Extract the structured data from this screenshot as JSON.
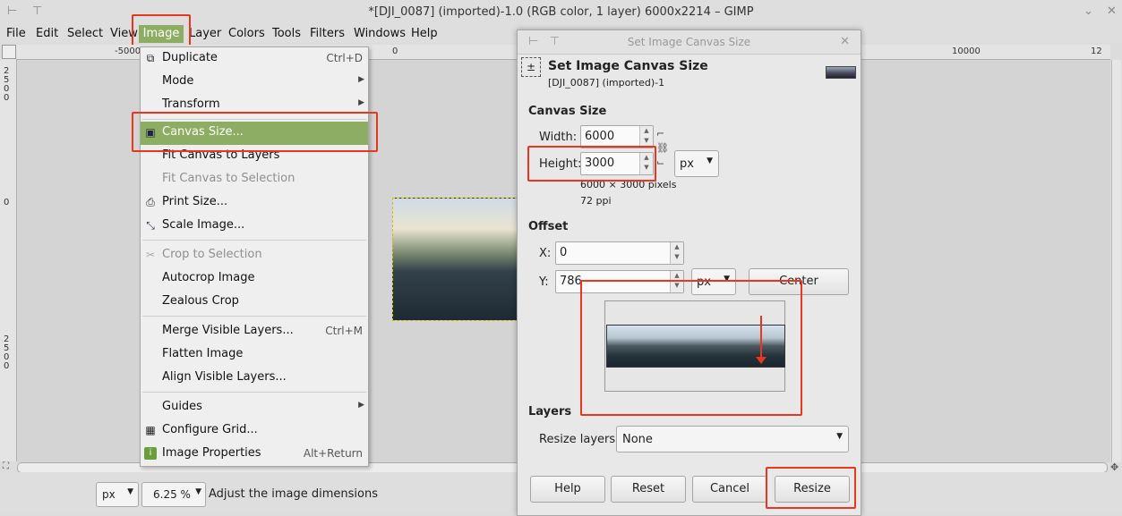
{
  "window": {
    "title": "*[DJI_0087] (imported)-1.0 (RGB color, 1 layer) 6000x2214 – GIMP",
    "pin_icon": "pin-icon",
    "up_icon": "up-arrow-icon"
  },
  "menubar": [
    "File",
    "Edit",
    "Select",
    "View",
    "Image",
    "Layer",
    "Colors",
    "Tools",
    "Filters",
    "Windows",
    "Help"
  ],
  "ruler": {
    "h_ticks": [
      "-5000",
      "0",
      "10000",
      "12"
    ],
    "v_ticks_top": [
      "2",
      "5",
      "0",
      "0"
    ],
    "v_tick_mid": "0",
    "v_ticks_bottom": [
      "2",
      "5",
      "0",
      "0"
    ]
  },
  "image_menu": {
    "items": [
      {
        "label": "Duplicate",
        "accel": "Ctrl+D",
        "icon": "duplicate-icon"
      },
      {
        "label": "Mode",
        "submenu": true
      },
      {
        "label": "Transform",
        "submenu": true
      },
      {
        "label": "Canvas Size...",
        "icon": "canvas-size-icon",
        "highlighted": true
      },
      {
        "label": "Fit Canvas to Layers"
      },
      {
        "label": "Fit Canvas to Selection",
        "disabled": true
      },
      {
        "label": "Print Size...",
        "icon": "print-size-icon"
      },
      {
        "label": "Scale Image...",
        "icon": "scale-image-icon"
      },
      {
        "label": "Crop to Selection",
        "icon": "crop-icon",
        "disabled": true
      },
      {
        "label": "Autocrop Image"
      },
      {
        "label": "Zealous Crop"
      },
      {
        "label": "Merge Visible Layers...",
        "accel": "Ctrl+M"
      },
      {
        "label": "Flatten Image"
      },
      {
        "label": "Align Visible Layers..."
      },
      {
        "label": "Guides",
        "submenu": true
      },
      {
        "label": "Configure Grid...",
        "icon": "grid-icon"
      },
      {
        "label": "Image Properties",
        "accel": "Alt+Return",
        "icon": "image-properties-icon"
      }
    ]
  },
  "dialog": {
    "window_title": "Set Image Canvas Size",
    "heading": "Set Image Canvas Size",
    "subtitle": "[DJI_0087] (imported)-1",
    "canvas_size_section": "Canvas Size",
    "width_label": "Width:",
    "width_value": "6000",
    "height_label": "Height:",
    "height_value": "3000",
    "unit": "px",
    "pixels_info": "6000 × 3000 pixels",
    "ppi_info": "72 ppi",
    "offset_section": "Offset",
    "x_label": "X:",
    "x_value": "0",
    "y_label": "Y:",
    "y_value": "786",
    "offset_unit": "px",
    "center_button": "Center",
    "layers_section": "Layers",
    "resize_layers_label": "Resize layers:",
    "resize_layers_value": "None",
    "buttons": {
      "help": "Help",
      "reset": "Reset",
      "cancel": "Cancel",
      "resize": "Resize"
    }
  },
  "statusbar": {
    "unit": "px",
    "zoom": "6.25 %",
    "message": "Adjust the image dimensions"
  },
  "highlight_color": "#e8371d",
  "menu_highlight_color": "#8dae62"
}
